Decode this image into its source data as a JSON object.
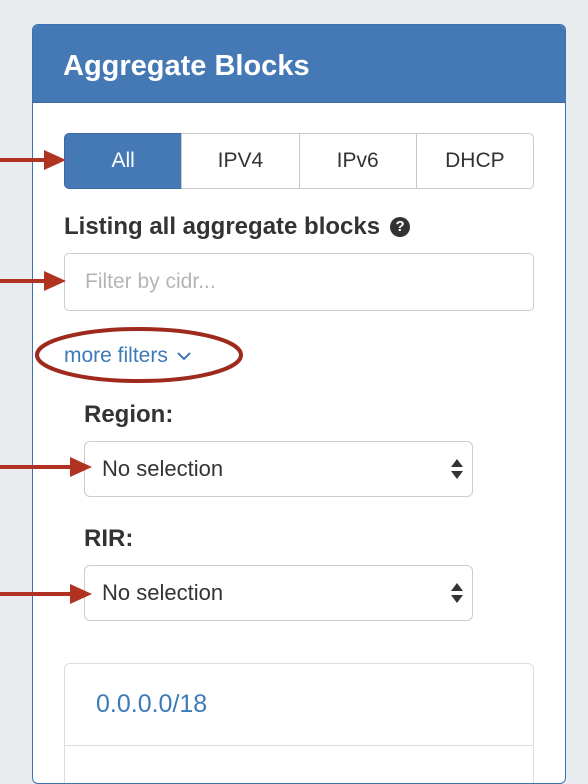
{
  "panel": {
    "title": "Aggregate Blocks"
  },
  "tabs": [
    {
      "label": "All",
      "active": true
    },
    {
      "label": "IPV4",
      "active": false
    },
    {
      "label": "IPv6",
      "active": false
    },
    {
      "label": "DHCP",
      "active": false
    }
  ],
  "listing": {
    "text": "Listing all aggregate blocks",
    "help_icon": "question-circle-icon"
  },
  "filter": {
    "placeholder": "Filter by cidr...",
    "value": ""
  },
  "more_filters": {
    "label": "more filters",
    "icon": "chevron-down-icon"
  },
  "region": {
    "label": "Region:",
    "selected": "No selection"
  },
  "rir": {
    "label": "RIR:",
    "selected": "No selection"
  },
  "blocks": [
    {
      "cidr": "0.0.0.0/18"
    }
  ],
  "annotation_colors": {
    "arrow": "#b03220",
    "ellipse": "#9e2a1e"
  },
  "colors": {
    "accent": "#4479b5",
    "link": "#3d7ab8"
  }
}
